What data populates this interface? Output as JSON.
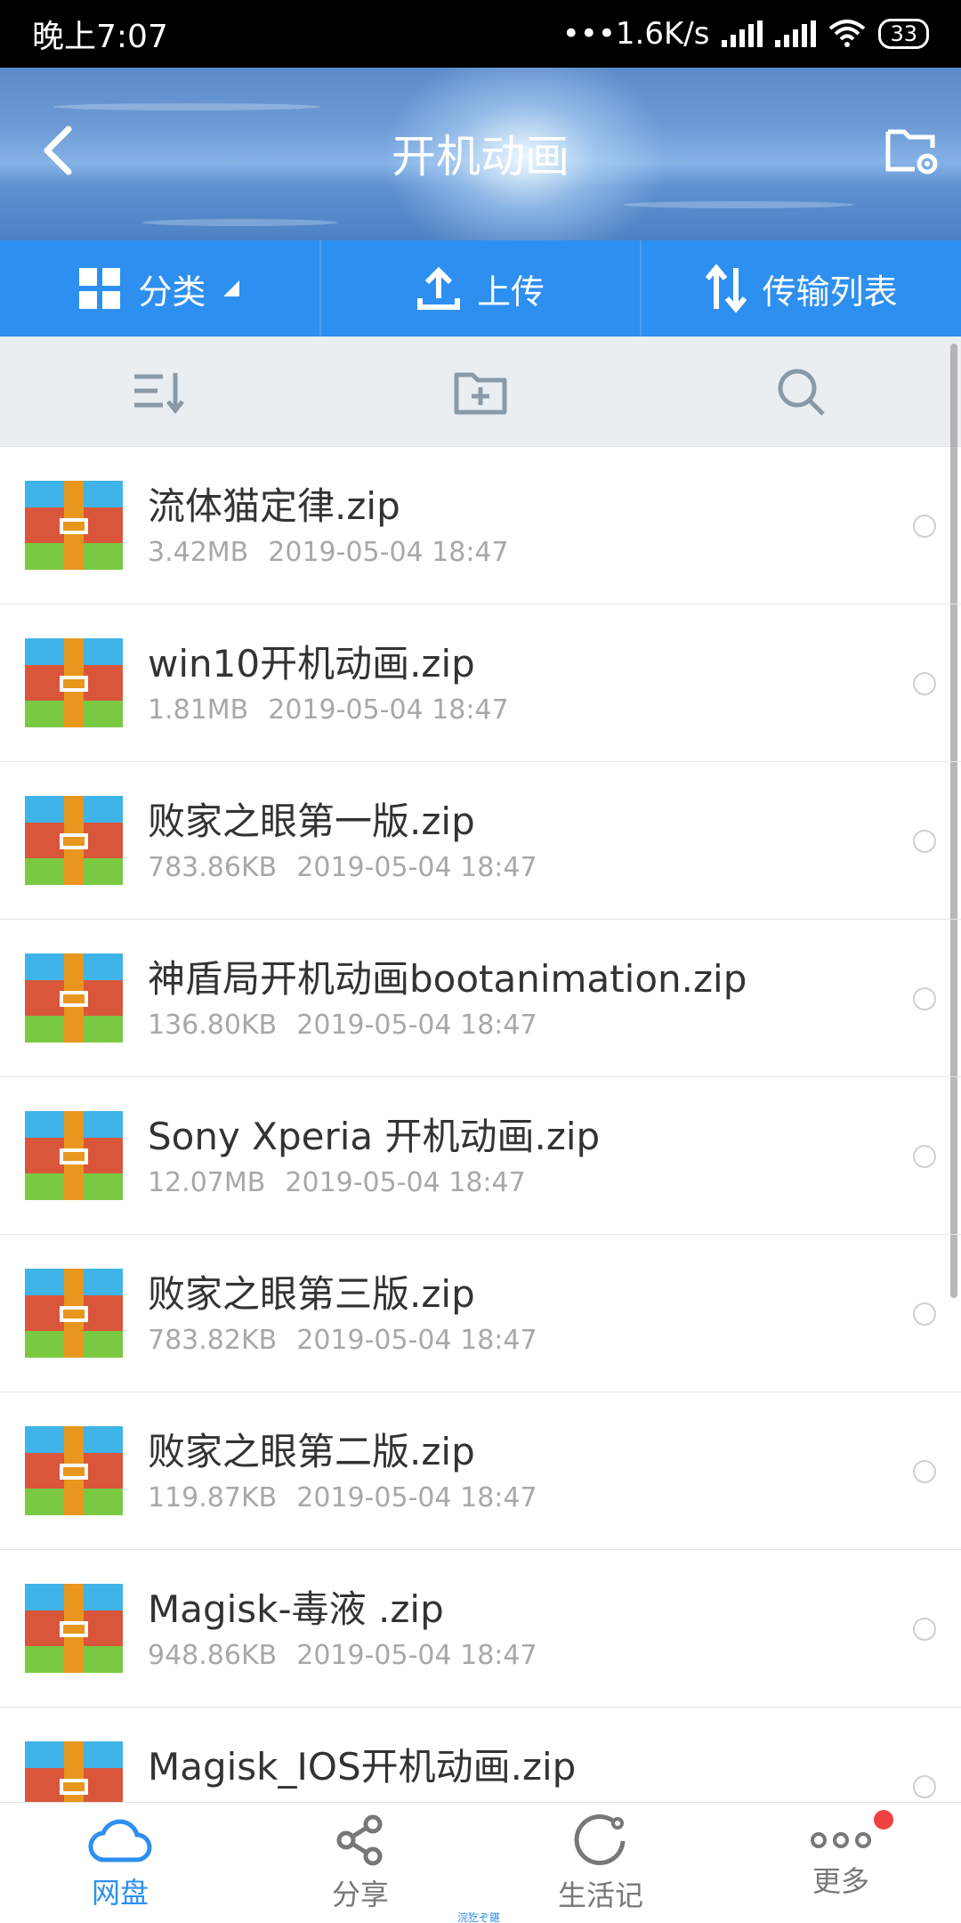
{
  "status_bar": {
    "time": "晚上7:07",
    "speed": "•••1.6K/s",
    "battery": "33"
  },
  "header": {
    "title": "开机动画",
    "back_icon": "chevron-left-icon",
    "settings_icon": "folder-settings-icon"
  },
  "toolbar": {
    "category": "分类",
    "upload": "上传",
    "transfer": "传输列表"
  },
  "files": [
    {
      "name": "流体猫定律.zip",
      "size": "3.42MB",
      "date": "2019-05-04  18:47"
    },
    {
      "name": "win10开机动画.zip",
      "size": "1.81MB",
      "date": "2019-05-04  18:47"
    },
    {
      "name": "败家之眼第一版.zip",
      "size": "783.86KB",
      "date": "2019-05-04  18:47"
    },
    {
      "name": "神盾局开机动画bootanimation.zip",
      "size": "136.80KB",
      "date": "2019-05-04  18:47"
    },
    {
      "name": "Sony Xperia 开机动画.zip",
      "size": "12.07MB",
      "date": "2019-05-04  18:47"
    },
    {
      "name": "败家之眼第三版.zip",
      "size": "783.82KB",
      "date": "2019-05-04  18:47"
    },
    {
      "name": "败家之眼第二版.zip",
      "size": "119.87KB",
      "date": "2019-05-04  18:47"
    },
    {
      "name": "Magisk-毒液 .zip",
      "size": "948.86KB",
      "date": "2019-05-04  18:47"
    },
    {
      "name": "Magisk_IOS开机动画.zip",
      "size": "",
      "date": ""
    }
  ],
  "bottom_nav": {
    "cloud": "网盘",
    "share": "分享",
    "life": "生活记",
    "more": "更多"
  },
  "watermark": "浣犵ぞ鍖",
  "colors": {
    "accent": "#2d8ff0",
    "badge": "#f04040"
  }
}
